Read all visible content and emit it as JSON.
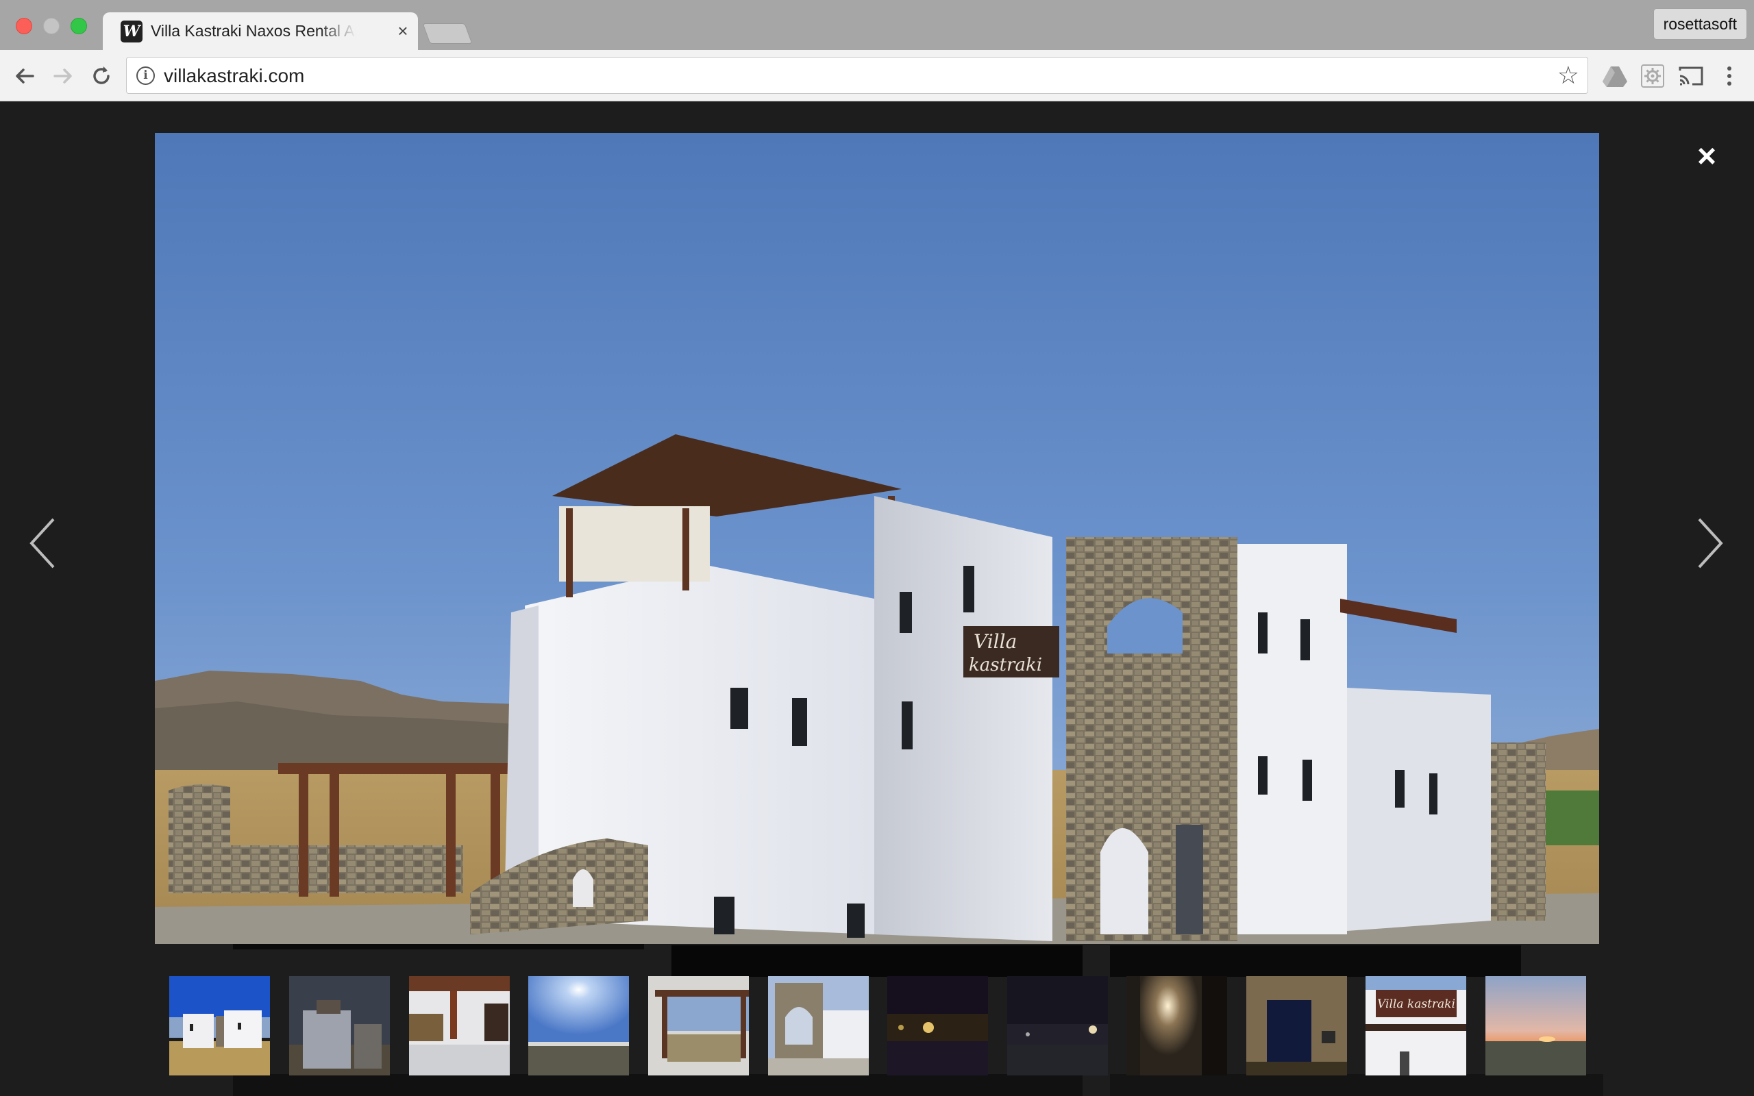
{
  "browser": {
    "tab_title": "Villa Kastraki Naxos Rental Apartments",
    "tab_favicon": "W",
    "tab_close": "×",
    "profile_name": "rosettasoft",
    "url": "villakastraki.com",
    "icons": [
      "back-arrow-icon",
      "forward-arrow-icon",
      "reload-icon",
      "info-icon",
      "star-icon",
      "drive-icon",
      "settings-gear-icon",
      "cast-icon",
      "menu-dots-icon"
    ]
  },
  "lightbox": {
    "close_label": "×",
    "main_photo_sign_line1": "Villa",
    "main_photo_sign_line2": "kastraki",
    "thumbnail_sign_text": "Villa kastraki",
    "thumbnails_count": 12,
    "selected_thumbnail_index": 0
  }
}
